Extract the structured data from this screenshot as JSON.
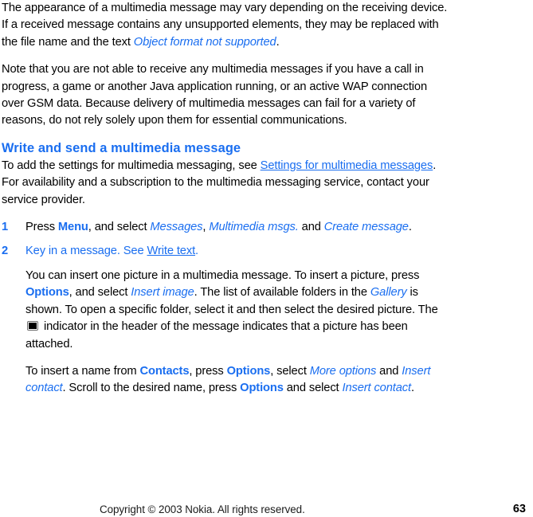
{
  "document": {
    "type": "user-guide-page",
    "page_number": "63",
    "accent_color": "#1a6ef0",
    "text_color": "#000000"
  },
  "paragraphs": {
    "intro": {
      "part1": "The appearance of a multimedia message may vary depending on the receiving device. If a received message contains any unsupported elements, they may be replaced with the file name and the text ",
      "emphasis": "Object format not supported",
      "part2": "."
    },
    "note": "Note that you are not able to receive any multimedia messages if you have a call in progress, a game or another Java application running, or an active WAP connection over GSM data. Because delivery of multimedia messages can fail for a variety of reasons, do not rely solely upon them for essential communications."
  },
  "section": {
    "heading": "Write and send a multimedia message",
    "lead": {
      "part1": "To add the settings for multimedia messaging, see ",
      "link": "Settings for multimedia messages",
      "part2": ". For availability and a subscription to the multimedia messaging service, contact your service provider."
    }
  },
  "steps": [
    {
      "number": "1",
      "segments": {
        "t1": "Press ",
        "key1": "Menu",
        "t2": ", and select ",
        "item1": "Messages",
        "t3": ", ",
        "item2": "Multimedia msgs.",
        "t4": " and ",
        "item3": "Create message",
        "t5": "."
      }
    },
    {
      "number": "2",
      "segments": {
        "t1": "Key in a message. See ",
        "link": "Write text",
        "t2": "."
      }
    }
  ],
  "body_blocks": {
    "insert_picture": {
      "t1": "You can insert one picture in a multimedia message. To insert a picture, press ",
      "key1": "Options",
      "t2": ", and select ",
      "item1": "Insert image",
      "t3": ". The list of available folders in the ",
      "item2": "Gallery",
      "t4": " is shown. To open a specific folder, select it and then select the desired picture. The ",
      "icon": "picture-attached-indicator-icon",
      "t5": " indicator in the header of the message indicates that a picture has been attached."
    },
    "insert_contact": {
      "t1": "To insert a name from ",
      "key1": "Contacts",
      "t2": ", press ",
      "key2": "Options",
      "t3": ", select ",
      "item1": "More options",
      "t4": " and ",
      "item2": "Insert contact",
      "t5": ". Scroll to the desired name, press ",
      "key3": "Options",
      "t6": " and select ",
      "item3": "Insert contact",
      "t7": "."
    }
  },
  "footer": {
    "copyright": "Copyright © 2003 Nokia. All rights reserved.",
    "page": "63"
  }
}
